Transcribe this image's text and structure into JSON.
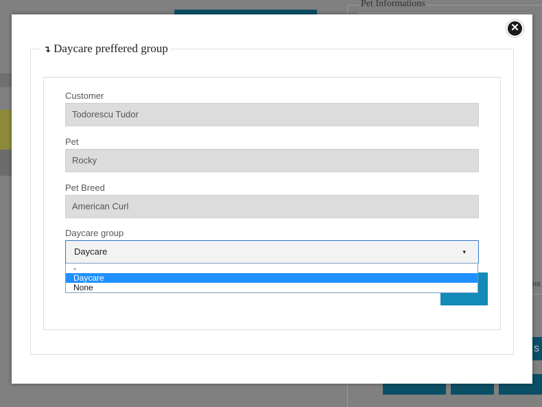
{
  "background": {
    "panel_title": "Pet Informations",
    "fragment_ns": "ns",
    "fragment_s": "S"
  },
  "modal": {
    "close_icon": "close-icon",
    "legend_icon": "↴",
    "legend_title": "Daycare preffered group",
    "fields": {
      "customer_label": "Customer",
      "customer_value": "Todorescu Tudor",
      "pet_label": "Pet",
      "pet_value": "Rocky",
      "breed_label": "Pet Breed",
      "breed_value": "American Curl",
      "group_label": "Daycare group",
      "group_selected": "Daycare"
    },
    "dropdown_options": [
      "-",
      "Daycare",
      "None"
    ]
  },
  "colors": {
    "accent": "#138ab8",
    "selection": "#1e90ff",
    "select_border": "#2f74d0"
  }
}
